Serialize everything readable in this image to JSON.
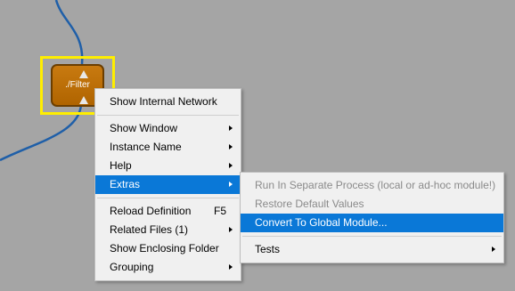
{
  "node": {
    "label": "./Filter"
  },
  "context_menu": {
    "items": [
      {
        "label": "Show Internal Network"
      },
      {
        "label": "Show Window"
      },
      {
        "label": "Instance Name"
      },
      {
        "label": "Help"
      },
      {
        "label": "Extras"
      },
      {
        "label": "Reload Definition",
        "shortcut": "F5"
      },
      {
        "label": "Related Files (1)"
      },
      {
        "label": "Show Enclosing Folder"
      },
      {
        "label": "Grouping"
      }
    ]
  },
  "extras_submenu": {
    "items": [
      {
        "label": "Run In Separate Process (local or ad-hoc module!)",
        "disabled": true
      },
      {
        "label": "Restore Default Values",
        "disabled": true
      },
      {
        "label": "Convert To Global Module..."
      },
      {
        "label": "Tests"
      }
    ]
  },
  "colors": {
    "canvas_bg": "#a5a5a5",
    "connection": "#1f5fa8",
    "node_fill": "#b96c08",
    "selection": "#ffee00",
    "menu_highlight": "#0a78d7"
  }
}
